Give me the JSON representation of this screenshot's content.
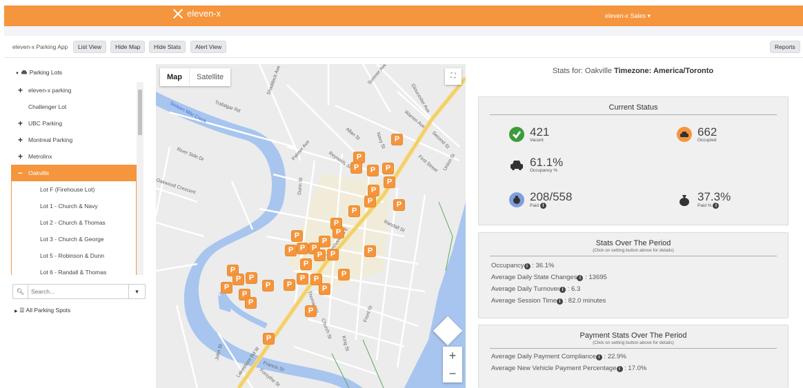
{
  "header": {
    "brand": "eleven-x",
    "brand_sub": "eleven-x",
    "user_menu": "eleven-x Sales ▾"
  },
  "toolbar": {
    "app_label": "eleven-x Parking App",
    "list_view": "List View",
    "hide_map": "Hide Map",
    "hide_stats": "Hide Stats",
    "alert_view": "Alert View",
    "reports": "Reports"
  },
  "sidebar": {
    "tree_head": "Parking Lots",
    "items": [
      {
        "label": "eleven-x parking",
        "type": "parent"
      },
      {
        "label": "Challenger Lot",
        "type": "plain"
      },
      {
        "label": "UBC Parking",
        "type": "parent"
      },
      {
        "label": "Montreal Parking",
        "type": "parent"
      },
      {
        "label": "Metrolinx",
        "type": "parent"
      },
      {
        "label": "Oakville",
        "type": "active"
      },
      {
        "label": "Lot F (Firehouse Lot)",
        "type": "child"
      },
      {
        "label": "Lot 1 - Church & Navy",
        "type": "child"
      },
      {
        "label": "Lot 2 - Church & Thomas",
        "type": "child"
      },
      {
        "label": "Lot 3 - Church & George",
        "type": "child"
      },
      {
        "label": "Lot 5 - Robinson & Dunn",
        "type": "child"
      },
      {
        "label": "Lot 6 - Randall & Thomas",
        "type": "child"
      }
    ],
    "search_placeholder": "Search...",
    "all_spots": "All Parking Spots"
  },
  "map": {
    "tab_map": "Map",
    "tab_satellite": "Satellite",
    "pin_glyph": "P",
    "zoom_in": "+",
    "zoom_out": "−",
    "street_labels": [
      "Trafalgar Rd",
      "Sixteen Mile Creek",
      "Lakeshore Rd E",
      "Lakeshore Rd W",
      "River Side Dr",
      "Oakwood Crescent",
      "Navy St",
      "Allan St",
      "Reynolds St",
      "Randall St",
      "Thomas St",
      "Church St",
      "King St",
      "Front St",
      "John St",
      "Francis St",
      "Forsythe St",
      "Union St",
      "First Street",
      "Second St",
      "Warren Ave",
      "Gloucester Ave",
      "Sumner Ave",
      "Shaddock Ave",
      "Palmer Ave",
      "Dunn St",
      "Robinson St",
      "Kerr St",
      "Queen Mary Dr",
      "Sheddon Ave"
    ]
  },
  "stats": {
    "title_prefix": "Stats for: Oakville",
    "timezone_label": "Timezone: America/Toronto",
    "current_status": {
      "title": "Current Status",
      "vacant_value": "421",
      "vacant_label": "Vacant",
      "occupied_value": "662",
      "occupied_label": "Occupied",
      "occupancy_value": "61.1%",
      "occupancy_label": "Occupancy %",
      "paid_value": "208/558",
      "paid_label": "Paid",
      "paid_pct_value": "37.3%",
      "paid_pct_label": "Paid %"
    },
    "period": {
      "title": "Stats Over The Period",
      "subtitle": "(Click on setting button above for details)",
      "occupancy_label": "Occupancy",
      "occupancy_value": ": 36.1%",
      "state_changes_label": "Average Daily State Changes",
      "state_changes_value": ": 13695",
      "turnover_label": "Average Daily Turnover",
      "turnover_value": ": 6.3",
      "session_label": "Average Session Time",
      "session_value": ": 82.0 minutes"
    },
    "payment": {
      "title": "Payment Stats Over The Period",
      "subtitle": "(Click on setting button above for details)",
      "compliance_label": "Average Daily Payment Compliance",
      "compliance_value": ": 22.9%",
      "new_vehicle_label": "Average New Vehicle Payment Percentage",
      "new_vehicle_value": ": 17.0%"
    }
  },
  "colors": {
    "accent": "#f5953d",
    "check_green": "#3c9c3c",
    "water": "#a7c5ee",
    "road": "#ffffff",
    "highway": "#f6d776"
  }
}
